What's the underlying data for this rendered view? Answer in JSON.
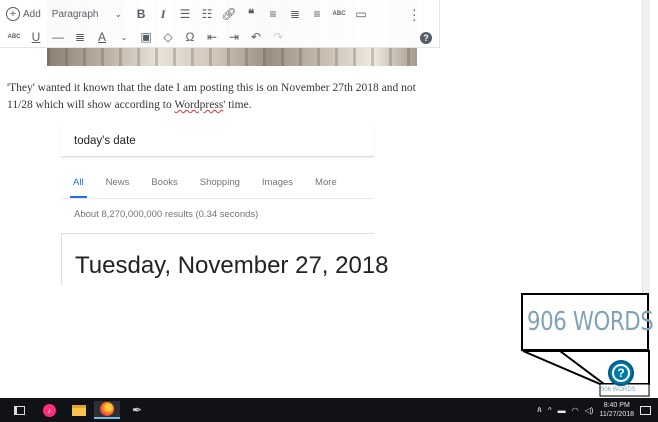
{
  "toolbar": {
    "add_label": "Add",
    "format_select": "Paragraph",
    "bold": "B",
    "italic": "I",
    "quote": "❝",
    "strikethrough_abc": "ABC",
    "abc_small": "ABC",
    "underline": "U",
    "text_color": "A",
    "special_char": "Ω",
    "help": "?"
  },
  "post": {
    "text_before": "'They' wanted it known that the date I am posting this is on November 27th 2018 and not 11/28 which will show according to ",
    "misspelled": "Wordpress",
    "text_after": "' time."
  },
  "google": {
    "query": "today's date",
    "tabs": [
      {
        "label": "All",
        "active": true
      },
      {
        "label": "News",
        "active": false
      },
      {
        "label": "Books",
        "active": false
      },
      {
        "label": "Shopping",
        "active": false
      },
      {
        "label": "Images",
        "active": false
      },
      {
        "label": "More",
        "active": false
      }
    ],
    "result_stats": "About 8,270,000,000 results (0.34 seconds)",
    "answer": "Tuesday, November 27, 2018"
  },
  "word_count": {
    "zoomed_label": "906 WORDS",
    "small_label": "906 WORDS",
    "icon": "?"
  },
  "taskbar": {
    "time": "8:40 PM",
    "date": "11/27/2018"
  },
  "colors": {
    "accent": "#0078a8",
    "google_blue": "#1a73e8",
    "wordcount_text": "#7fa3b9"
  }
}
